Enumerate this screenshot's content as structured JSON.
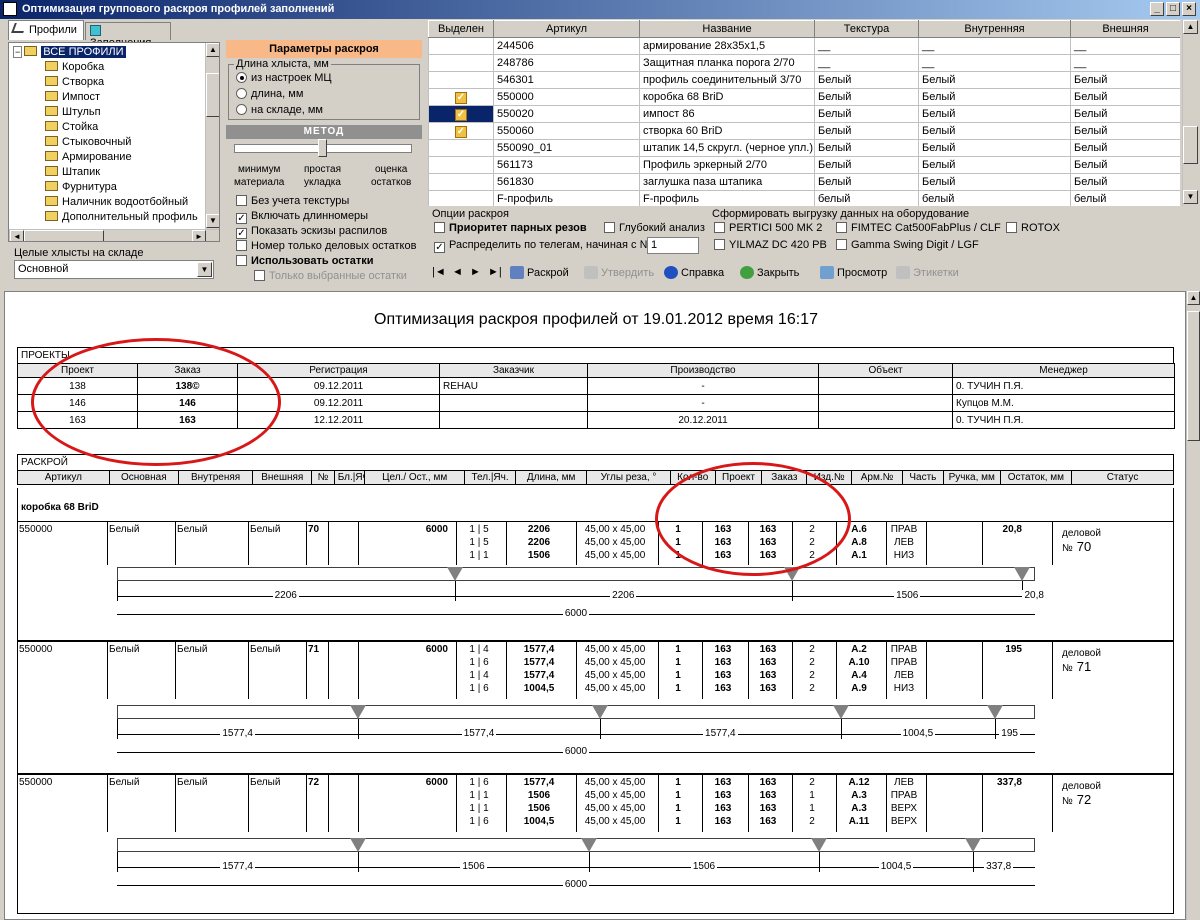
{
  "window": {
    "title": "Оптимизация группового раскроя профилей заполнений"
  },
  "tabs": [
    "Профили",
    "Заполнения"
  ],
  "tree": {
    "root": "ВСЕ ПРОФИЛИ",
    "items": [
      "Коробка",
      "Створка",
      "Импост",
      "Штульп",
      "Стойка",
      "Стыковочный",
      "Армирование",
      "Штапик",
      "Фурнитура",
      "Наличник водоотбойный",
      "Дополнительный профиль"
    ]
  },
  "stock": {
    "label": "Целые хлысты на складе",
    "value": "Основной"
  },
  "params": {
    "title": "Параметры раскроя",
    "length_group": "Длина хлыста, мм",
    "radios": [
      "из настроек МЦ",
      "длина, мм",
      "на складе, мм"
    ],
    "method_title": "МЕТОД",
    "slider_labels": [
      "минимум\nматериала",
      "простая\nукладка",
      "оценка\nостатков"
    ],
    "checks": [
      {
        "label": "Без учета текстуры",
        "checked": false
      },
      {
        "label": "Включать длинномеры",
        "checked": true
      },
      {
        "label": "Показать эскизы распилов",
        "checked": true
      },
      {
        "label": "Номер только деловых остатков",
        "checked": false
      },
      {
        "label": "Использовать остатки",
        "checked": false
      },
      {
        "label": "Только выбранные остатки",
        "checked": false
      }
    ]
  },
  "grid": {
    "headers": [
      "Выделен",
      "Артикул",
      "Название",
      "Текстура",
      "Внутренняя",
      "Внешняя"
    ],
    "rows": [
      {
        "sel": false,
        "art": "244506",
        "name": "армирование 28х35х1,5",
        "tex": "__",
        "in": "__",
        "out": "__"
      },
      {
        "sel": false,
        "art": "248786",
        "name": "Защитная планка порога 2/70",
        "tex": "__",
        "in": "__",
        "out": "__"
      },
      {
        "sel": false,
        "art": "546301",
        "name": "профиль соединительный 3/70",
        "tex": "Белый",
        "in": "Белый",
        "out": "Белый"
      },
      {
        "sel": true,
        "art": "550000",
        "name": "коробка 68 BriD",
        "tex": "Белый",
        "in": "Белый",
        "out": "Белый"
      },
      {
        "sel": true,
        "art": "550020",
        "name": "импост 86",
        "tex": "Белый",
        "in": "Белый",
        "out": "Белый"
      },
      {
        "sel": true,
        "art": "550060",
        "name": "створка 60 BriD",
        "tex": "Белый",
        "in": "Белый",
        "out": "Белый"
      },
      {
        "sel": false,
        "art": "550090_01",
        "name": "штапик 14,5 скругл. (черное упл.)",
        "tex": "Белый",
        "in": "Белый",
        "out": "Белый"
      },
      {
        "sel": false,
        "art": "561173",
        "name": "Профиль эркерный 2/70",
        "tex": "Белый",
        "in": "Белый",
        "out": "Белый"
      },
      {
        "sel": false,
        "art": "561830",
        "name": "заглушка паза штапика",
        "tex": "Белый",
        "in": "Белый",
        "out": "Белый"
      },
      {
        "sel": false,
        "art": "F-профиль",
        "name": "F-профиль",
        "tex": "белый",
        "in": "белый",
        "out": "белый"
      }
    ]
  },
  "options": {
    "title": "Опции раскроя",
    "priority": "Приоритет парных резов",
    "deep": "Глубокий анализ",
    "distribute": "Распределить по телегам, начиная с №",
    "distribute_value": "1"
  },
  "export": {
    "title": "Сформировать выгрузку данных на оборудование",
    "items": [
      "PERTICI 500 MK 2",
      "FIMTEC Cat500FabPlus / CLF",
      "ROTOX",
      "YILMAZ DC 420 PB",
      "Gamma Swing Digit / LGF"
    ]
  },
  "toolbar": {
    "cut": "Раскрой",
    "approve": "Утвердить",
    "help": "Справка",
    "close": "Закрыть",
    "preview": "Просмотр",
    "labels": "Этикетки"
  },
  "report": {
    "title": "Оптимизация раскроя профилей от 19.01.2012 время 16:17",
    "projects_label": "ПРОЕКТЫ",
    "proj_headers": [
      "Проект",
      "Заказ",
      "Регистрация",
      "Заказчик",
      "Производство",
      "Объект",
      "Менеджер"
    ],
    "projects": [
      [
        "138",
        "138©",
        "09.12.2011",
        "REHAU",
        "-",
        "",
        "0. ТУЧИН П.Я."
      ],
      [
        "146",
        "146",
        "09.12.2011",
        "",
        "-",
        "",
        "Купцов М.М."
      ],
      [
        "163",
        "163",
        "12.12.2011",
        "",
        "20.12.2011",
        "",
        "0. ТУЧИН П.Я."
      ]
    ],
    "cut_label": "РАСКРОЙ",
    "cut_headers": [
      "Артикул",
      "Основная",
      "Внутреняя",
      "Внешняя",
      "№",
      "Бл.|Яч.",
      "Цел./ Ост., мм",
      "Тел.|Яч.",
      "Длина, мм",
      "Углы реза, °",
      "Кол-во",
      "Проект",
      "Заказ",
      "Изд.№",
      "Арм.№",
      "Часть",
      "Ручка, мм",
      "Остаток, мм",
      "Статус"
    ],
    "group": "коробка 68 BriD",
    "bars": [
      {
        "art": "550000",
        "main": "Белый",
        "in": "Белый",
        "out": "Белый",
        "no": "70",
        "total": "6000",
        "cuts": [
          [
            "1 | 5",
            "2206",
            "45,00 x 45,00",
            "1",
            "163",
            "163",
            "2",
            "А.6",
            "ПРАВ"
          ],
          [
            "1 | 5",
            "2206",
            "45,00 x 45,00",
            "1",
            "163",
            "163",
            "2",
            "А.8",
            "ЛЕВ"
          ],
          [
            "1 | 1",
            "1506",
            "45,00 x 45,00",
            "1",
            "163",
            "163",
            "2",
            "А.1",
            "НИЗ"
          ]
        ],
        "rest": "20,8",
        "status": "деловой №",
        "status_no": "70",
        "pieces": [
          "2206",
          "2206",
          "1506",
          "20,8"
        ],
        "piece_lengths": [
          2206,
          2206,
          1506,
          20.8
        ],
        "total_label": "6000"
      },
      {
        "art": "550000",
        "main": "Белый",
        "in": "Белый",
        "out": "Белый",
        "no": "71",
        "total": "6000",
        "cuts": [
          [
            "1 | 4",
            "1577,4",
            "45,00 x 45,00",
            "1",
            "163",
            "163",
            "2",
            "А.2",
            "ПРАВ"
          ],
          [
            "1 | 6",
            "1577,4",
            "45,00 x 45,00",
            "1",
            "163",
            "163",
            "2",
            "А.10",
            "ПРАВ"
          ],
          [
            "1 | 4",
            "1577,4",
            "45,00 x 45,00",
            "1",
            "163",
            "163",
            "2",
            "А.4",
            "ЛЕВ"
          ],
          [
            "1 | 6",
            "1004,5",
            "45,00 x 45,00",
            "1",
            "163",
            "163",
            "2",
            "А.9",
            "НИЗ"
          ]
        ],
        "rest": "195",
        "status": "деловой №",
        "status_no": "71",
        "pieces": [
          "1577,4",
          "1577,4",
          "1577,4",
          "1004,5",
          "195"
        ],
        "piece_lengths": [
          1577.4,
          1577.4,
          1577.4,
          1004.5,
          195
        ],
        "total_label": "6000"
      },
      {
        "art": "550000",
        "main": "Белый",
        "in": "Белый",
        "out": "Белый",
        "no": "72",
        "total": "6000",
        "cuts": [
          [
            "1 | 6",
            "1577,4",
            "45,00 x 45,00",
            "1",
            "163",
            "163",
            "2",
            "А.12",
            "ЛЕВ"
          ],
          [
            "1 | 1",
            "1506",
            "45,00 x 45,00",
            "1",
            "163",
            "163",
            "1",
            "А.3",
            "ПРАВ"
          ],
          [
            "1 | 1",
            "1506",
            "45,00 x 45,00",
            "1",
            "163",
            "163",
            "1",
            "А.3",
            "ВЕРХ"
          ],
          [
            "1 | 6",
            "1004,5",
            "45,00 x 45,00",
            "1",
            "163",
            "163",
            "2",
            "А.11",
            "ВЕРХ"
          ]
        ],
        "rest": "337,8",
        "status": "деловой №",
        "status_no": "72",
        "pieces": [
          "1577,4",
          "1506",
          "1506",
          "1004,5",
          "337,8"
        ],
        "piece_lengths": [
          1577.4,
          1506,
          1506,
          1004.5,
          337.8
        ],
        "total_label": "6000"
      }
    ]
  }
}
